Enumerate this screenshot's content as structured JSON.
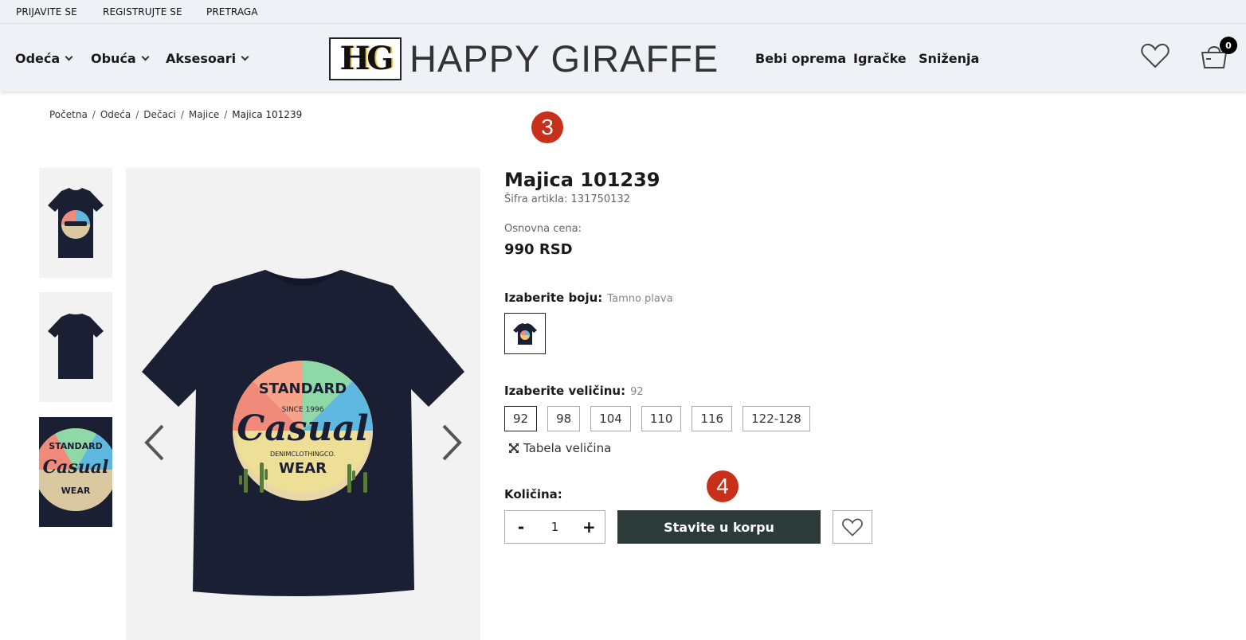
{
  "topbar": {
    "login": "PRIJAVITE SE",
    "register": "REGISTRUJTE SE",
    "search": "PRETRAGA"
  },
  "nav": {
    "left": [
      {
        "label": "Odeća"
      },
      {
        "label": "Obuća"
      },
      {
        "label": "Aksesoari"
      }
    ],
    "right": [
      {
        "label": "Bebi oprema"
      },
      {
        "label": "Igračke"
      },
      {
        "label": "Sniženja"
      }
    ]
  },
  "logo": {
    "mark": "HG",
    "text": "HAPPY GIRAFFE"
  },
  "cart": {
    "count": "0"
  },
  "breadcrumb": {
    "items": [
      "Početna",
      "Odeća",
      "Dečaci",
      "Majice"
    ],
    "current": "Majica 101239",
    "separator": "/"
  },
  "markers": {
    "m3": "3",
    "m4": "4"
  },
  "product": {
    "title": "Majica 101239",
    "sku": "Šifra artikla: 131750132",
    "base_price_label": "Osnovna cena:",
    "price": "990 RSD",
    "color_label": "Izaberite boju:",
    "color_value": "Tamno plava",
    "size_label": "Izaberite veličinu:",
    "size_value": "92",
    "sizes": [
      "92",
      "98",
      "104",
      "110",
      "116",
      "122-128"
    ],
    "size_chart": "Tabela veličina",
    "qty_label": "Količina:",
    "qty": "1",
    "qty_minus": "-",
    "qty_plus": "+",
    "add_to_cart": "Stavite u korpu"
  },
  "print": {
    "line1": "STANDARD",
    "line2": "SINCE 1996",
    "line3": "Casual",
    "line4": "DENIMCLOTHINGCO.",
    "line5": "WEAR"
  },
  "colors": {
    "header_bg": "#eef1f5",
    "button_bg": "#2c3b3a",
    "marker": "#c9301b",
    "shirt": "#1b1f33"
  }
}
